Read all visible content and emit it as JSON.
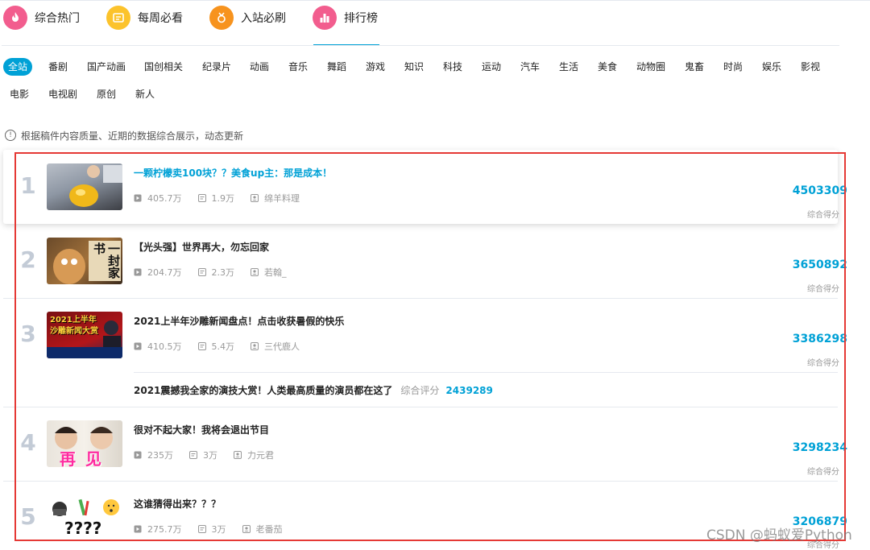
{
  "top_nav": [
    {
      "label": "综合热门",
      "icon": "flame-icon",
      "color": "#f25d8e"
    },
    {
      "label": "每周必看",
      "icon": "calendar-icon",
      "color": "#fcc32c"
    },
    {
      "label": "入站必刷",
      "icon": "medal-icon",
      "color": "#f7931e"
    },
    {
      "label": "排行榜",
      "icon": "chart-icon",
      "color": "#f25d8e",
      "active": true
    }
  ],
  "tags_row1": [
    "全站",
    "番剧",
    "国产动画",
    "国创相关",
    "纪录片",
    "动画",
    "音乐",
    "舞蹈",
    "游戏",
    "知识",
    "科技",
    "运动",
    "汽车",
    "生活",
    "美食",
    "动物圈",
    "鬼畜",
    "时尚",
    "娱乐",
    "影视"
  ],
  "tags_row2": [
    "电影",
    "电视剧",
    "原创",
    "新人"
  ],
  "accent_color": "#00a1d6",
  "notice": "根据稿件内容质量、近期的数据综合展示，动态更新",
  "score_label": "综合得分",
  "list": [
    {
      "rank": "1",
      "title": "一颗柠檬卖100块？？美食up主：那是成本！",
      "plays": "405.7万",
      "danmaku": "1.9万",
      "author": "绵羊料理",
      "score": "4503309"
    },
    {
      "rank": "2",
      "title": "【光头强】世界再大，勿忘回家",
      "plays": "204.7万",
      "danmaku": "2.3万",
      "author": "若翰_",
      "score": "3650892"
    },
    {
      "rank": "3",
      "title": "2021上半年沙雕新闻盘点！点击收获暑假的快乐",
      "plays": "410.5万",
      "danmaku": "5.4万",
      "author": "三代鹿人",
      "score": "3386298"
    },
    {
      "rank": "4",
      "title": "很对不起大家！我将会退出节目",
      "plays": "235万",
      "danmaku": "3万",
      "author": "力元君",
      "score": "3298234"
    },
    {
      "rank": "5",
      "title": "这谁猜得出来？？？",
      "plays": "275.7万",
      "danmaku": "3万",
      "author": "老番茄",
      "score": "3206879"
    }
  ],
  "extra_item": {
    "title": "2021震撼我全家的演技大赏！人类最高质量的演员都在这了",
    "label": "综合评分",
    "score": "2439289"
  },
  "thumbnails": {
    "thumb2_text": "一封家书",
    "thumb3_text": "2021上半年沙雕新闻大赏",
    "thumb4_text": "再见",
    "thumb5_text": "????"
  },
  "watermark": "CSDN @蚂蚁爱Python"
}
